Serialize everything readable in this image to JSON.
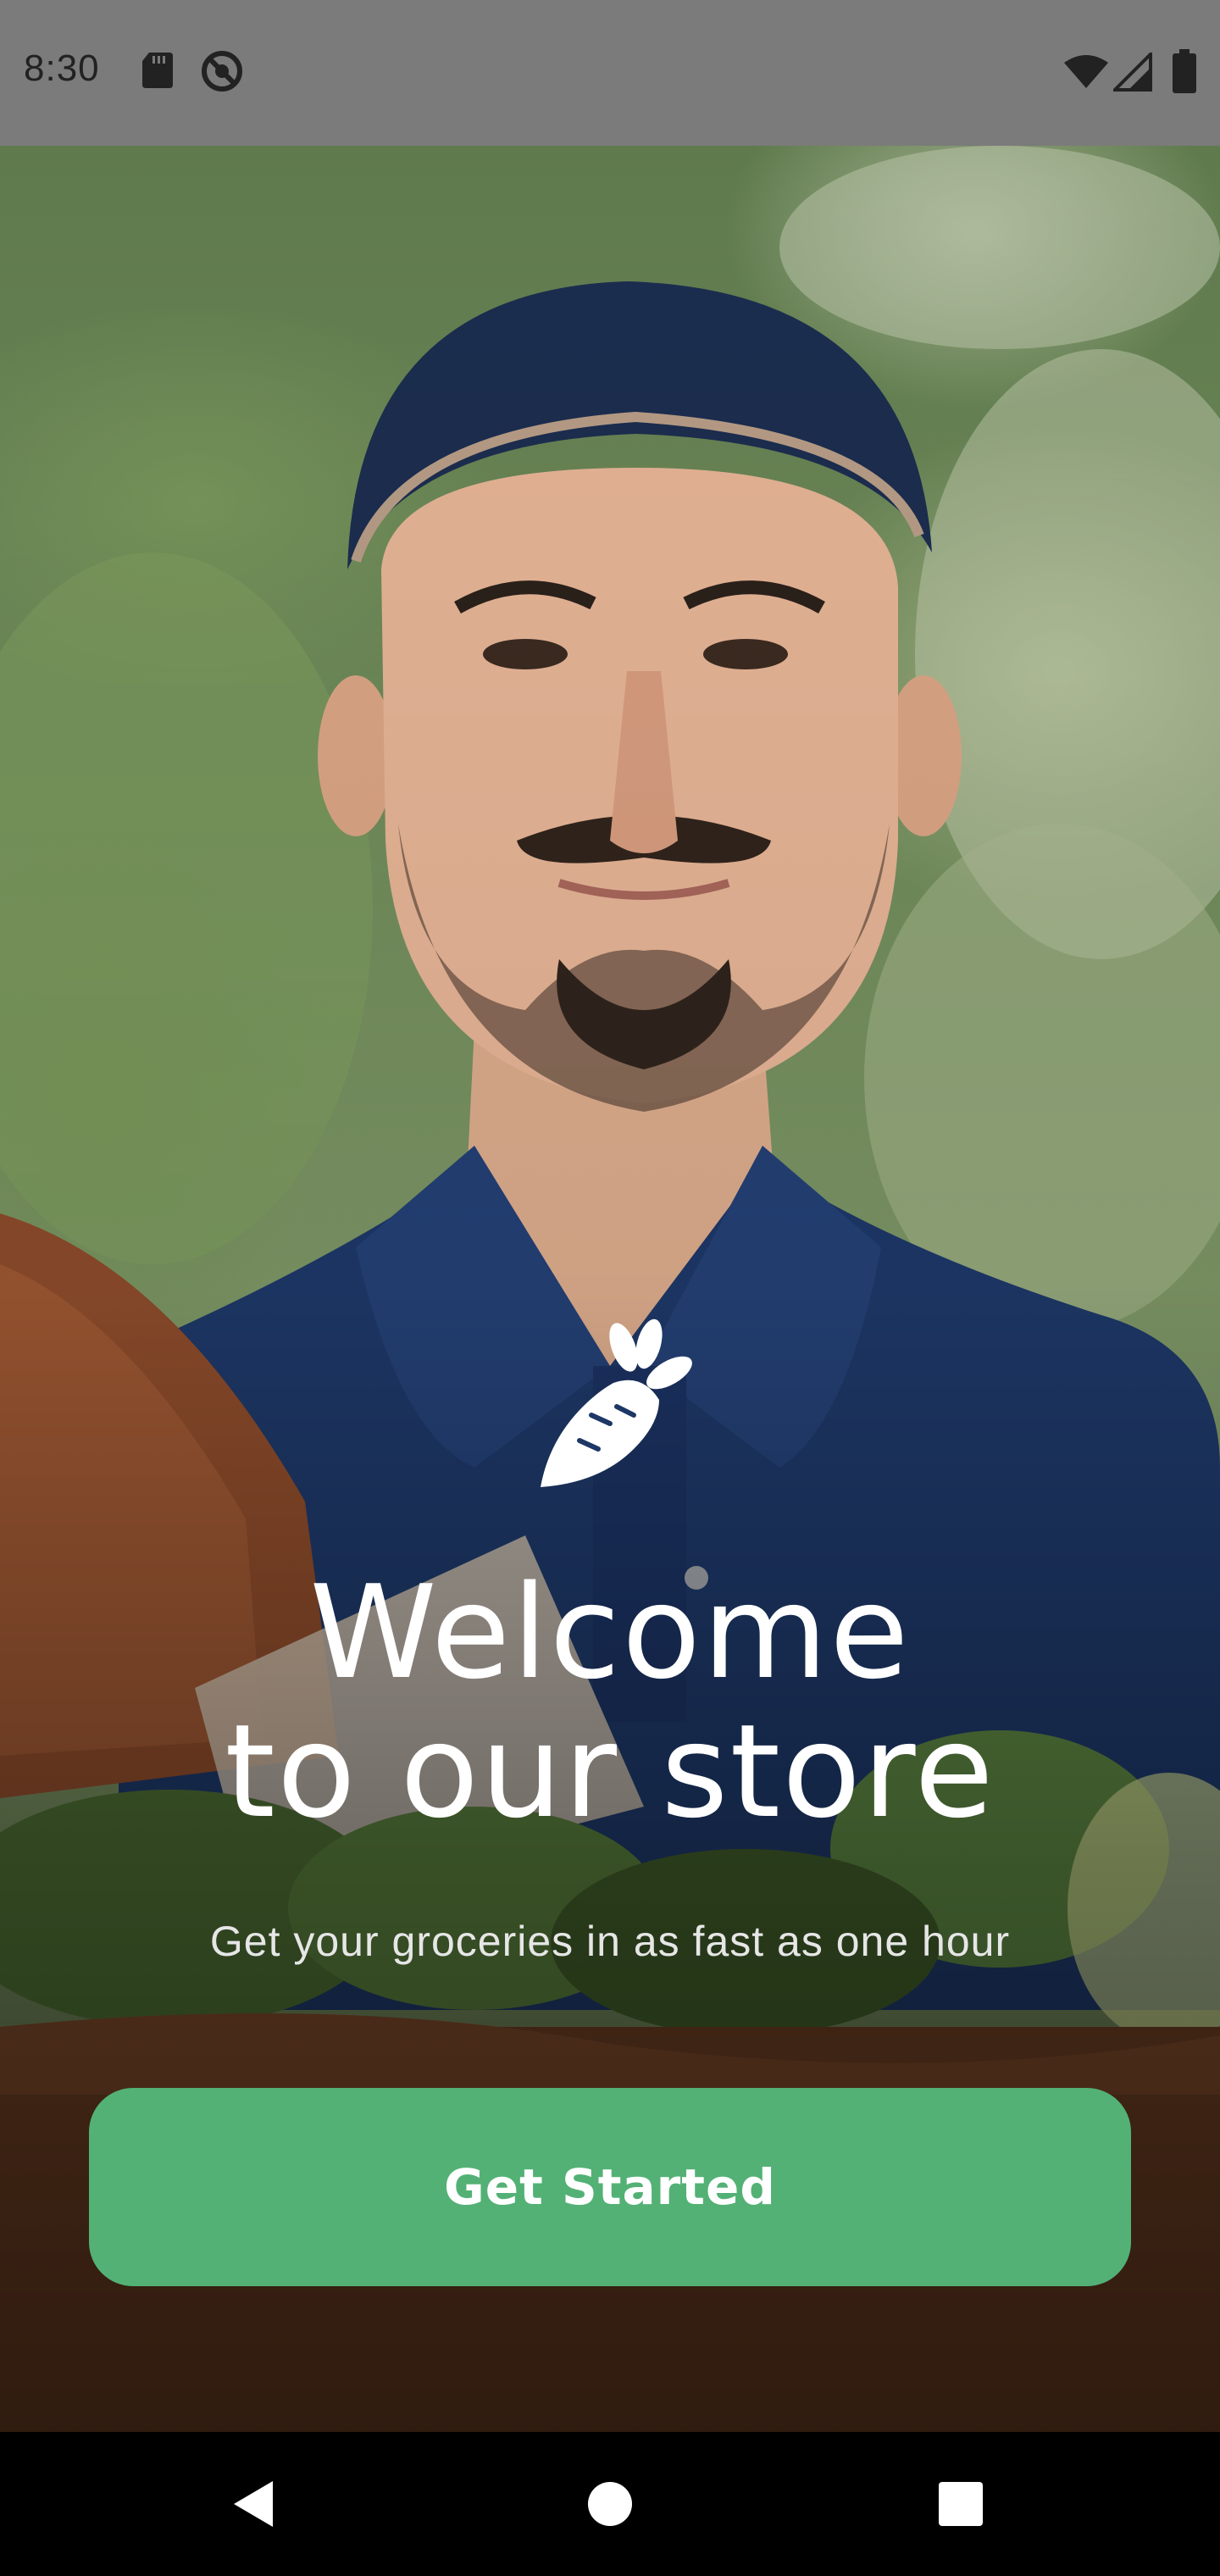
{
  "status_bar": {
    "time": "8:30",
    "left_icons": [
      "sd-card-icon",
      "do-not-disturb-icon"
    ],
    "right_icons": [
      "wifi-icon",
      "signal-icon",
      "battery-icon"
    ]
  },
  "hero": {
    "image": "delivery-man-photo"
  },
  "onboarding": {
    "logo_icon": "carrot-icon",
    "headline_line1": "Welcome",
    "headline_line2": "to our store",
    "subtitle": "Get your groceries in as fast as one hour",
    "cta_label": "Get Started"
  },
  "colors": {
    "accent": "#53b175",
    "status_bar": "#7b7b7b",
    "nav_bar": "#000000",
    "text": "#ffffff"
  },
  "nav_bar": {
    "buttons": [
      "back-icon",
      "home-icon",
      "recents-icon"
    ]
  }
}
